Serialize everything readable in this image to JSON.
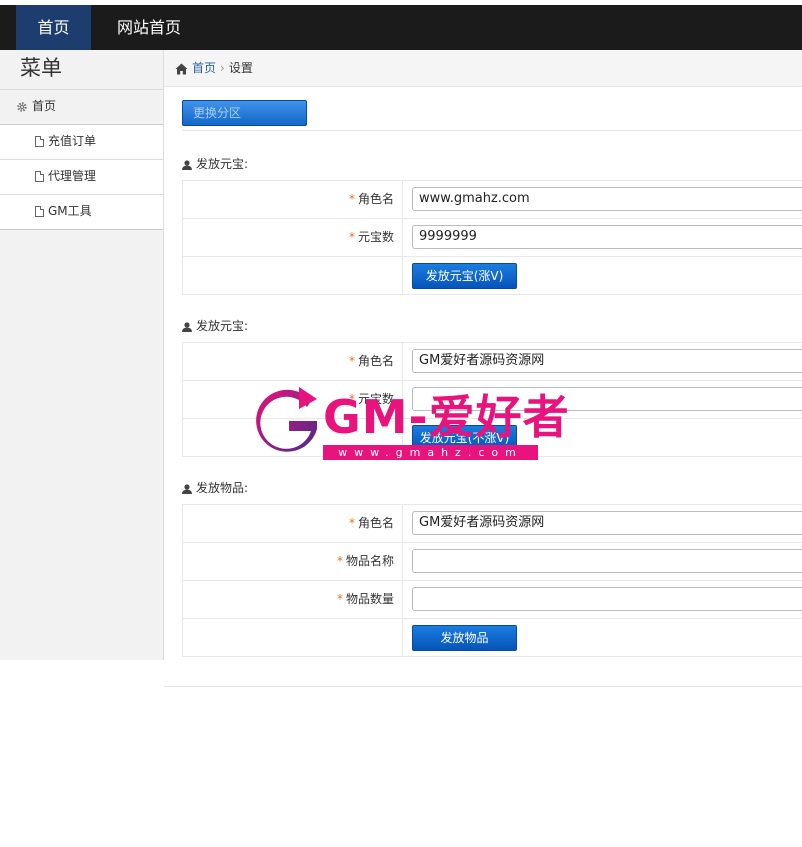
{
  "topnav": {
    "home": "首页",
    "site_home": "网站首页"
  },
  "sidebar": {
    "title": "菜单",
    "home": "首页",
    "items": [
      {
        "label": "充值订单"
      },
      {
        "label": "代理管理"
      },
      {
        "label": "GM工具"
      }
    ]
  },
  "breadcrumb": {
    "home": "首页",
    "current": "设置"
  },
  "toolbar": {
    "switch_zone": "更换分区"
  },
  "sections": [
    {
      "title": "发放元宝:",
      "rows": [
        {
          "label": "角色名",
          "value": "www.gmahz.com"
        },
        {
          "label": "元宝数",
          "value": "9999999"
        }
      ],
      "button": "发放元宝(涨V)"
    },
    {
      "title": "发放元宝:",
      "rows": [
        {
          "label": "角色名",
          "value": "GM爱好者源码资源网"
        },
        {
          "label": "元宝数",
          "value": ""
        }
      ],
      "button": "发放元宝(不涨V)"
    },
    {
      "title": "发放物品:",
      "rows": [
        {
          "label": "角色名",
          "value": "GM爱好者源码资源网"
        },
        {
          "label": "物品名称",
          "value": ""
        },
        {
          "label": "物品数量",
          "value": ""
        }
      ],
      "button": "发放物品"
    }
  ],
  "watermark": {
    "brand": "GM-爱好者",
    "url": "www.gmahz.com"
  },
  "colors": {
    "topbar": "#1b1b1b",
    "active_nav": "#1c3d6e",
    "button": "#0a5fc7",
    "required_star": "#e8712c",
    "watermark": "#e8137c"
  }
}
